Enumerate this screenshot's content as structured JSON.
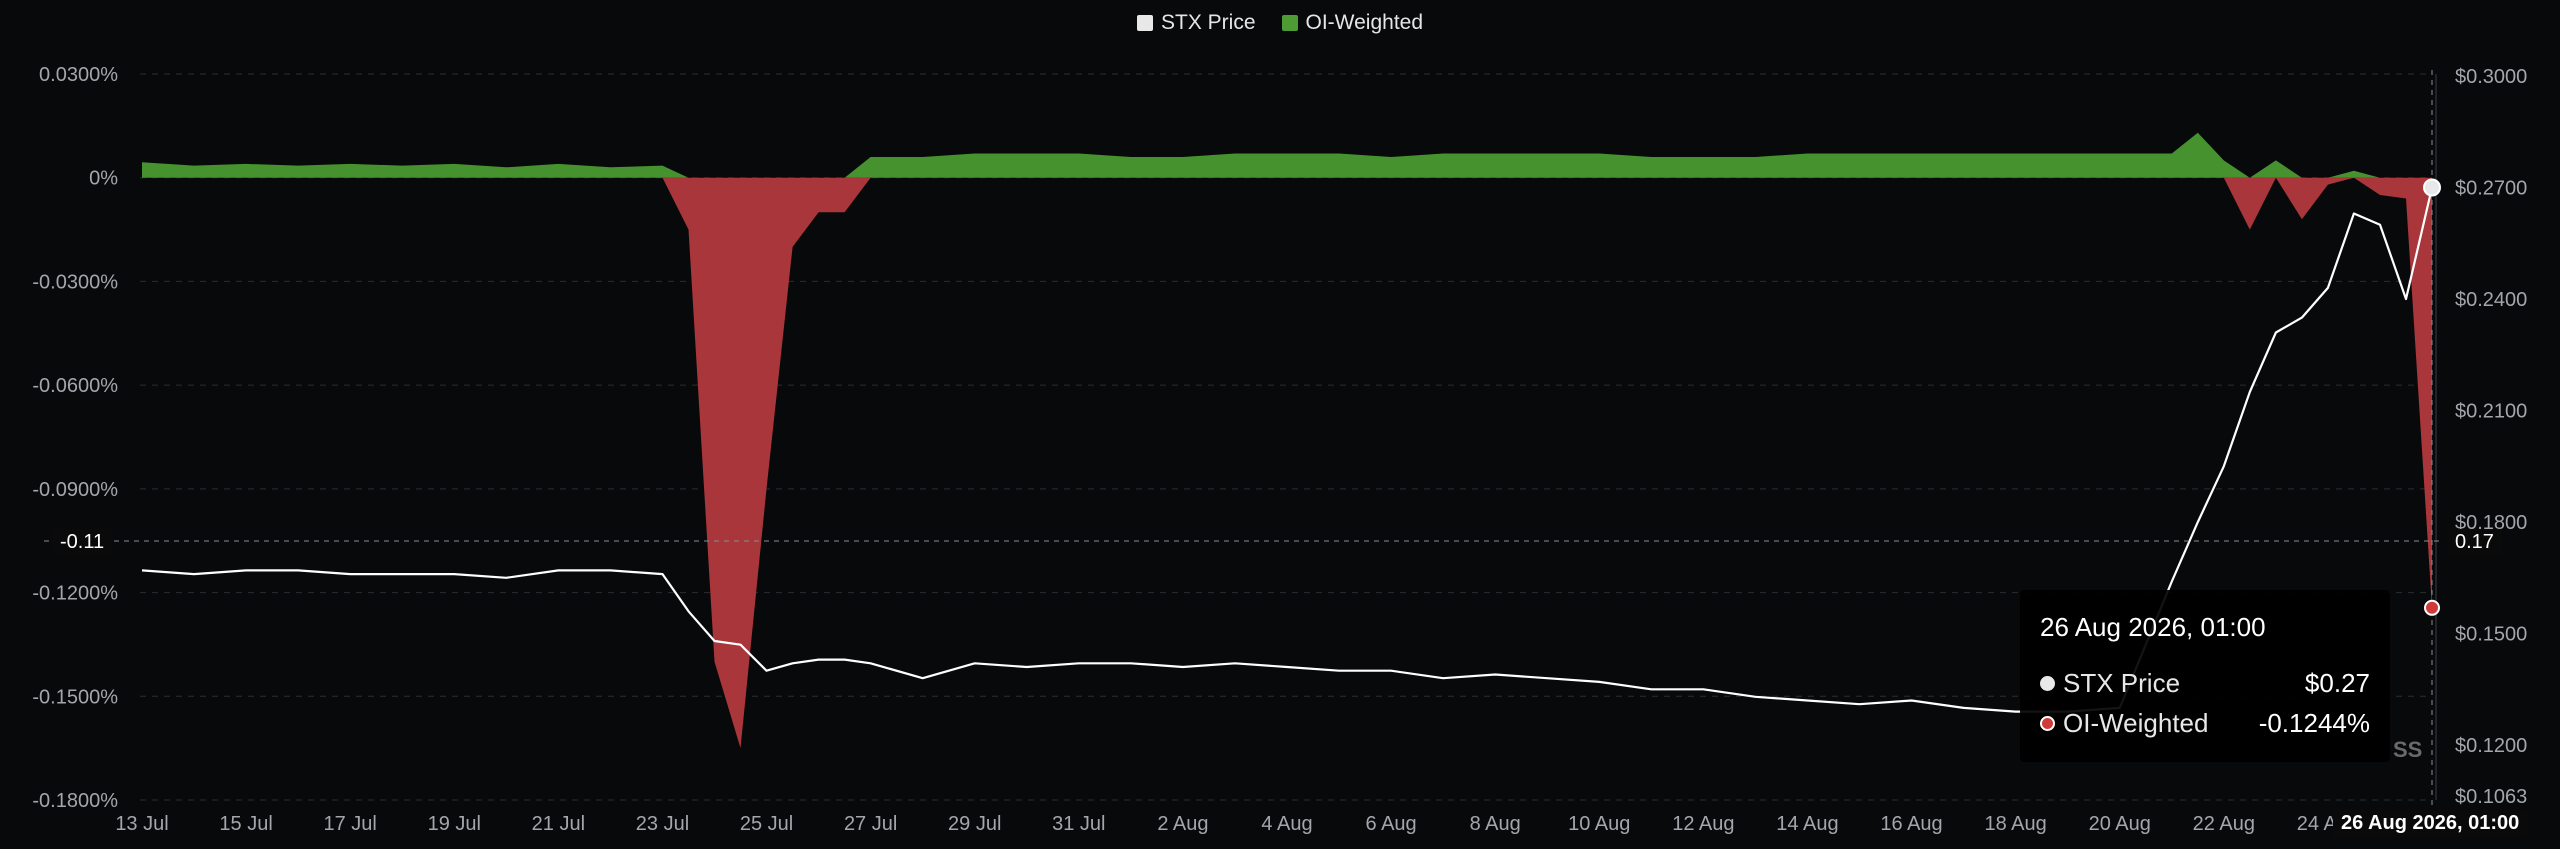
{
  "legend": {
    "price_label": "STX Price",
    "oi_label": "OI-Weighted"
  },
  "colors": {
    "price_swatch": "#e8e8e8",
    "oi_swatch": "#4e9a35",
    "positive_fill": "#45922f",
    "negative_fill": "#a8363a",
    "price_line": "#ffffff",
    "grid": "#2a2d33"
  },
  "tooltip": {
    "title": "26 Aug 2026, 01:00",
    "rows": [
      {
        "label": "STX Price",
        "value": "$0.27",
        "dot_color": "#e8e8e8"
      },
      {
        "label": "OI-Weighted",
        "value": "-0.1244%",
        "dot_color": "#d03a3a"
      }
    ]
  },
  "crosshair": {
    "left_value": "-0.11",
    "right_value": "0.17",
    "x_label": "26 Aug 2026, 01:00"
  },
  "watermark": "SS",
  "chart_data": {
    "type": "area",
    "title": "",
    "x": [
      "13 Jul",
      "14 Jul",
      "15 Jul",
      "16 Jul",
      "17 Jul",
      "18 Jul",
      "19 Jul",
      "20 Jul",
      "21 Jul",
      "22 Jul",
      "23 Jul",
      "23.5 Jul",
      "24 Jul",
      "24.5 Jul",
      "25 Jul",
      "25.5 Jul",
      "26 Jul",
      "26.5 Jul",
      "27 Jul",
      "28 Jul",
      "29 Jul",
      "30 Jul",
      "31 Jul",
      "1 Aug",
      "2 Aug",
      "3 Aug",
      "4 Aug",
      "5 Aug",
      "6 Aug",
      "7 Aug",
      "8 Aug",
      "9 Aug",
      "10 Aug",
      "11 Aug",
      "12 Aug",
      "13 Aug",
      "14 Aug",
      "15 Aug",
      "16 Aug",
      "17 Aug",
      "18 Aug",
      "19 Aug",
      "20 Aug",
      "21 Aug",
      "21.5 Aug",
      "22 Aug",
      "22.5 Aug",
      "23 Aug",
      "23.5 Aug",
      "24 Aug",
      "24.5 Aug",
      "25 Aug",
      "25.5 Aug",
      "26 Aug"
    ],
    "x_tick_labels": [
      "13 Jul",
      "15 Jul",
      "17 Jul",
      "19 Jul",
      "21 Jul",
      "23 Jul",
      "25 Jul",
      "27 Jul",
      "29 Jul",
      "31 Jul",
      "2 Aug",
      "4 Aug",
      "6 Aug",
      "8 Aug",
      "10 Aug",
      "12 Aug",
      "14 Aug",
      "16 Aug",
      "18 Aug",
      "20 Aug",
      "22 Aug",
      "24 Aug"
    ],
    "series": [
      {
        "name": "OI-Weighted",
        "axis": "left",
        "unit": "%",
        "values": [
          0.0045,
          0.0035,
          0.004,
          0.0035,
          0.004,
          0.0035,
          0.004,
          0.003,
          0.004,
          0.003,
          0.0035,
          -0.015,
          -0.14,
          -0.165,
          -0.09,
          -0.02,
          -0.01,
          -0.01,
          0.006,
          0.006,
          0.007,
          0.007,
          0.007,
          0.006,
          0.006,
          0.007,
          0.007,
          0.007,
          0.006,
          0.007,
          0.007,
          0.007,
          0.007,
          0.006,
          0.006,
          0.006,
          0.007,
          0.007,
          0.007,
          0.007,
          0.007,
          0.007,
          0.007,
          0.007,
          0.013,
          0.005,
          -0.015,
          0.005,
          -0.012,
          -0.002,
          0.002,
          -0.005,
          -0.006,
          -0.1244
        ]
      },
      {
        "name": "STX Price",
        "axis": "right",
        "unit": "$",
        "values": [
          0.167,
          0.166,
          0.167,
          0.167,
          0.166,
          0.166,
          0.166,
          0.165,
          0.167,
          0.167,
          0.166,
          0.156,
          0.148,
          0.147,
          0.14,
          0.142,
          0.143,
          0.143,
          0.142,
          0.138,
          0.142,
          0.141,
          0.142,
          0.142,
          0.141,
          0.142,
          0.141,
          0.14,
          0.14,
          0.138,
          0.139,
          0.138,
          0.137,
          0.135,
          0.135,
          0.133,
          0.132,
          0.131,
          0.132,
          0.13,
          0.129,
          0.129,
          0.13,
          0.164,
          0.18,
          0.195,
          0.215,
          0.231,
          0.235,
          0.243,
          0.263,
          0.26,
          0.24,
          0.27
        ]
      }
    ],
    "y_left": {
      "ticks": [
        "0.0300%",
        "0%",
        "-0.0300%",
        "-0.0600%",
        "-0.0900%",
        "-0.1200%",
        "-0.1500%",
        "-0.1800%"
      ],
      "ylim": [
        -0.18,
        0.03
      ]
    },
    "y_right": {
      "ticks": [
        "$0.3000",
        "$0.2700",
        "$0.2400",
        "$0.2100",
        "$0.1800",
        "$0.1500",
        "$0.1200",
        "$0.1063"
      ],
      "ylim": [
        0.1063,
        0.3
      ]
    },
    "grid": true,
    "legend_position": "top-center"
  }
}
